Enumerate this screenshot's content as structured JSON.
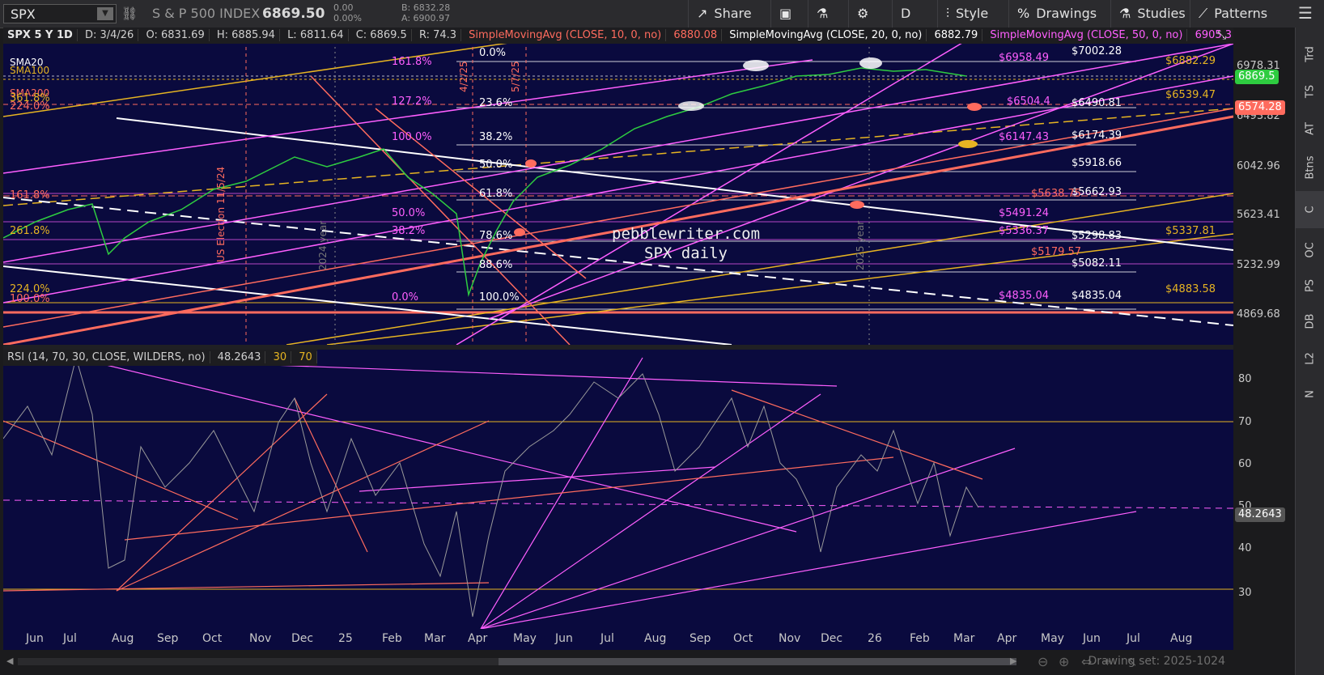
{
  "toolbar": {
    "symbol": "SPX",
    "index_name": "S & P 500 INDEX",
    "last_price": "6869.50",
    "net_change": "0.00",
    "pct_change": "0.00%",
    "bid": "B: 6832.28",
    "ask": "A: 6900.97",
    "share": "Share",
    "period": "D",
    "style": "Style",
    "drawings": "Drawings",
    "studies": "Studies",
    "patterns": "Patterns"
  },
  "price_header": {
    "symbol_period": "SPX 5 Y 1D",
    "date": "D: 3/4/26",
    "open": "O: 6831.69",
    "high": "H: 6885.94",
    "low": "L: 6811.64",
    "close": "C: 6869.5",
    "range": "R: 74.3",
    "sma10": "SimpleMovingAvg (CLOSE, 10, 0, no)",
    "sma10_val": "6880.08",
    "sma20": "SimpleMovingAvg (CLOSE, 20, 0, no)",
    "sma20_val": "6882.79",
    "sma50": "SimpleMovingAvg (CLOSE, 50, 0, no)",
    "sma50_val": "6905.3"
  },
  "price_axis": [
    "6978.31",
    "6493.82",
    "6042.96",
    "5623.41",
    "5232.99",
    "4869.68"
  ],
  "price_tags": {
    "current": "6869.5",
    "sma": "6574.28"
  },
  "fib_levels_left": [
    "161.8%",
    "127.2%",
    "100.0%",
    "50.0%",
    "38.2%",
    "0.0%",
    "161.8%",
    "261.8%",
    "224.0%",
    "100.0%",
    "361.8%",
    "224.0%"
  ],
  "fib_levels_mid": [
    "0.0%",
    "23.6%",
    "38.2%",
    "50.0%",
    "61.8%",
    "78.6%",
    "88.6%",
    "100.0%"
  ],
  "price_labels_white": [
    "$7002.28",
    "$6490.81",
    "$6174.39",
    "$5918.66",
    "$5662.93",
    "$5298.83",
    "$5082.11",
    "$4835.04"
  ],
  "price_labels_pink": [
    "$6958.49",
    "$6504.4",
    "$6147.43",
    "$5638.75",
    "$5491.24",
    "$5336.37",
    "$5179.57",
    "$4835.04"
  ],
  "price_labels_gold": [
    "$6882.29",
    "$6539.47",
    "$5337.81",
    "$4883.58"
  ],
  "watermark": {
    "line1": "pebblewriter.com",
    "line2": "SPX daily"
  },
  "vertical_notes": [
    "US Election 11/5/24",
    "2024 year",
    "2025 year",
    "4/2/25",
    "5/7/25"
  ],
  "sma_left_labels": [
    "SMA20",
    "SMA100",
    "SMA200"
  ],
  "rsi_header": {
    "label": "RSI (14, 70, 30, CLOSE, WILDERS, no)",
    "value": "48.2643",
    "ob": "30",
    "os": "70"
  },
  "rsi_axis": [
    "80",
    "70",
    "60",
    "50",
    "40",
    "30"
  ],
  "rsi_tag": "48.2643",
  "x_axis": [
    "Jun",
    "Jul",
    "Aug",
    "Sep",
    "Oct",
    "Nov",
    "Dec",
    "25",
    "Feb",
    "Mar",
    "Apr",
    "May",
    "Jun",
    "Jul",
    "Aug",
    "Sep",
    "Oct",
    "Nov",
    "Dec",
    "26",
    "Feb",
    "Mar",
    "Apr",
    "May",
    "Jun",
    "Jul",
    "Aug"
  ],
  "drawing_set": "Drawing set: 2025-1024",
  "right_rail": [
    "Trd",
    "TS",
    "AT",
    "Btns",
    "C",
    "OC",
    "PS",
    "DB",
    "L2",
    "N"
  ],
  "colors": {
    "bg": "#0a0a3e",
    "pink": "#ff5fff",
    "salmon": "#ff6b5e",
    "gold": "#e6b422",
    "white": "#ffffff",
    "green": "#2ecc40"
  }
}
